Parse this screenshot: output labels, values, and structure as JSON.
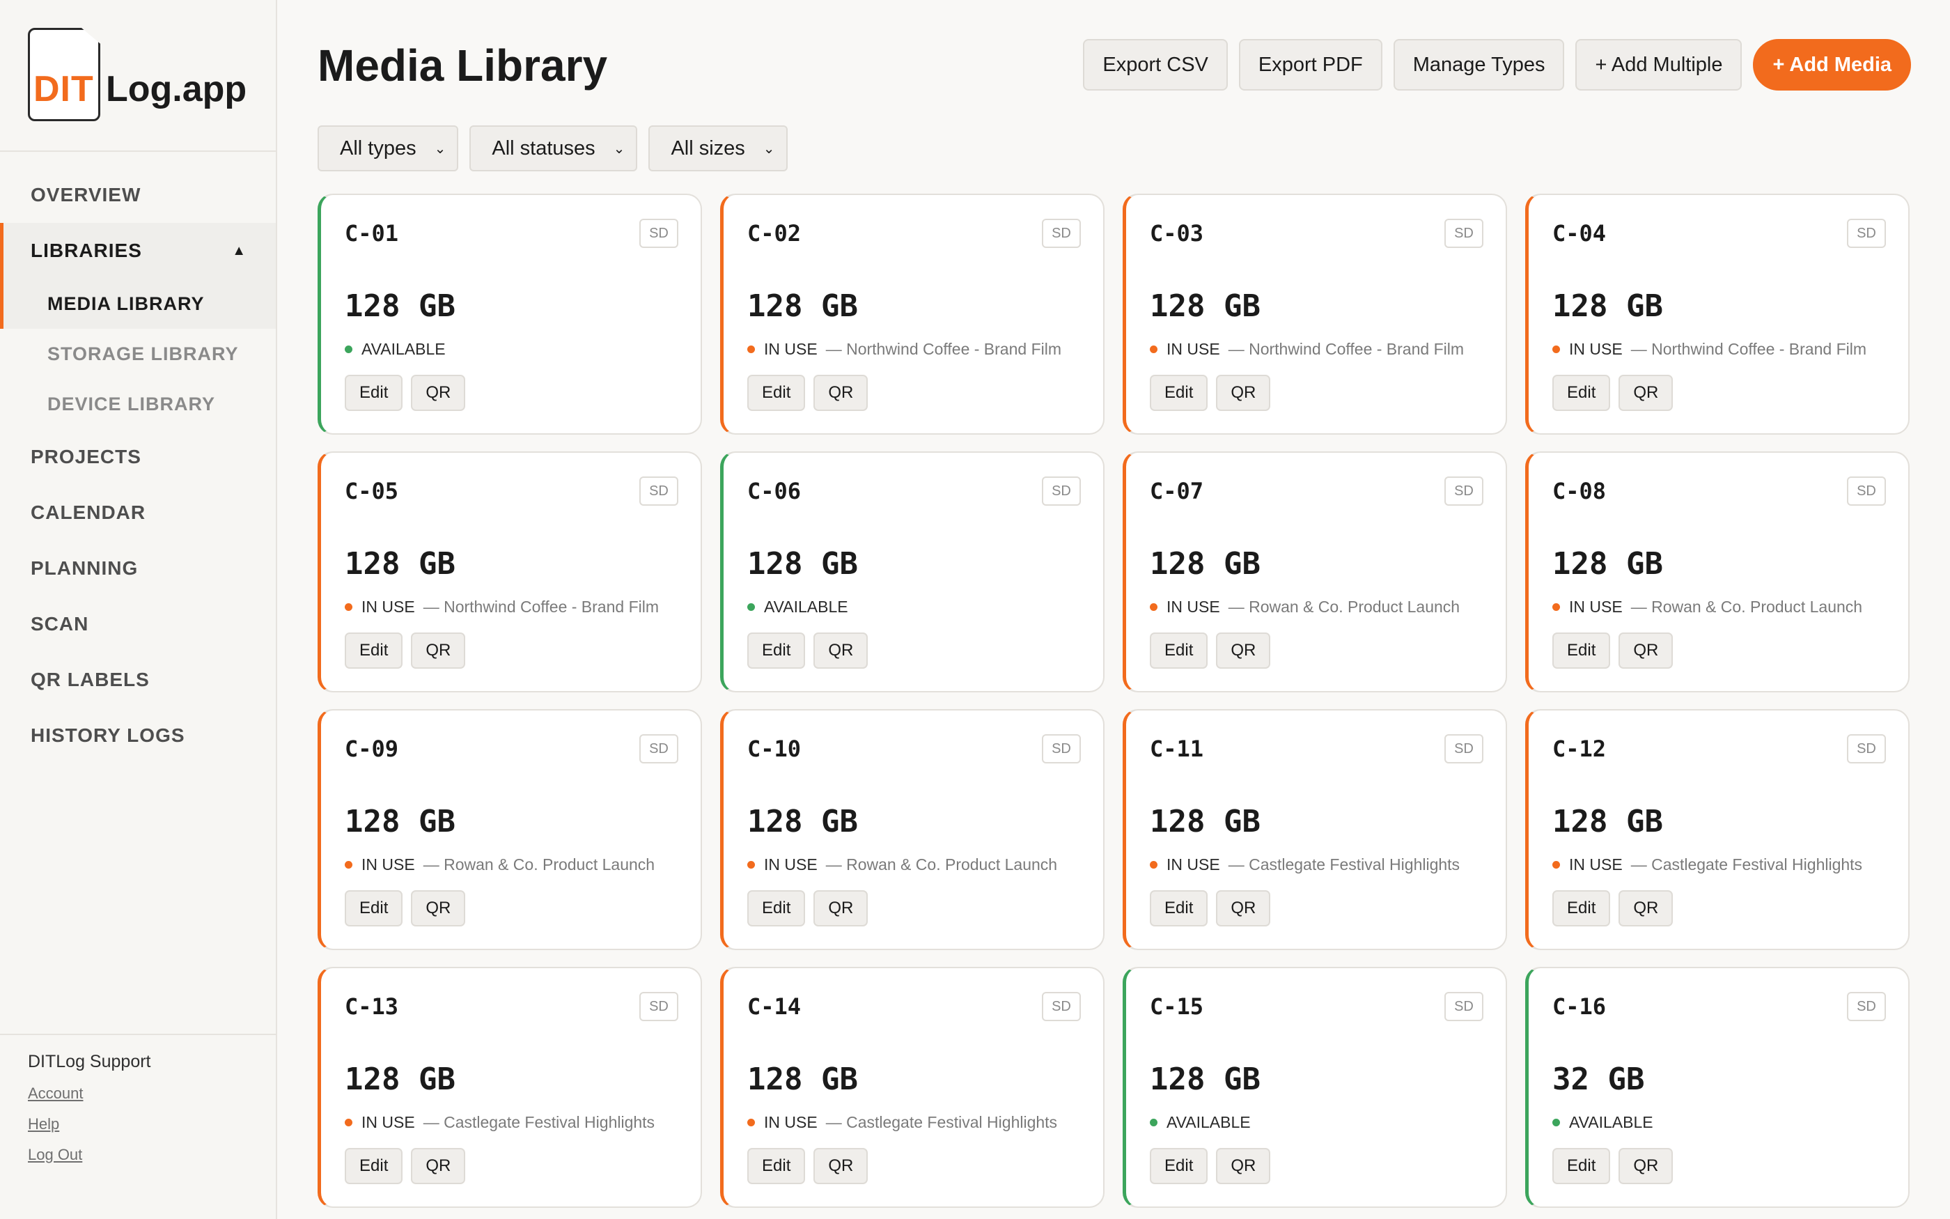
{
  "brand": {
    "logo_prefix": "DIT",
    "logo_suffix": "Log.app"
  },
  "sidebar": {
    "nav": [
      {
        "label": "OVERVIEW"
      },
      {
        "label": "LIBRARIES",
        "expanded_indicator": "▲"
      },
      {
        "label": "PROJECTS"
      },
      {
        "label": "CALENDAR"
      },
      {
        "label": "PLANNING"
      },
      {
        "label": "SCAN"
      },
      {
        "label": "QR LABELS"
      },
      {
        "label": "HISTORY LOGS"
      }
    ],
    "libraries_sub": [
      {
        "label": "MEDIA LIBRARY"
      },
      {
        "label": "STORAGE LIBRARY"
      },
      {
        "label": "DEVICE LIBRARY"
      }
    ],
    "footer": {
      "support": "DITLog Support",
      "links": [
        "Account",
        "Help",
        "Log Out"
      ]
    }
  },
  "header": {
    "title": "Media Library",
    "actions": [
      "Export CSV",
      "Export PDF",
      "Manage Types",
      "+ Add Multiple",
      "+ Add Media"
    ]
  },
  "filters": {
    "type": "All types",
    "status": "All statuses",
    "size": "All sizes"
  },
  "colors": {
    "accent": "#f26b1d",
    "in_use": "#f26b1d",
    "available": "#3ca55c"
  },
  "card_actions": {
    "edit": "Edit",
    "qr": "QR"
  },
  "media": [
    {
      "id": "C-01",
      "type": "SD",
      "size": "128 GB",
      "status": "AVAILABLE",
      "project": ""
    },
    {
      "id": "C-02",
      "type": "SD",
      "size": "128 GB",
      "status": "IN USE",
      "project": "— Northwind Coffee - Brand Film"
    },
    {
      "id": "C-03",
      "type": "SD",
      "size": "128 GB",
      "status": "IN USE",
      "project": "— Northwind Coffee - Brand Film"
    },
    {
      "id": "C-04",
      "type": "SD",
      "size": "128 GB",
      "status": "IN USE",
      "project": "— Northwind Coffee - Brand Film"
    },
    {
      "id": "C-05",
      "type": "SD",
      "size": "128 GB",
      "status": "IN USE",
      "project": "— Northwind Coffee - Brand Film"
    },
    {
      "id": "C-06",
      "type": "SD",
      "size": "128 GB",
      "status": "AVAILABLE",
      "project": ""
    },
    {
      "id": "C-07",
      "type": "SD",
      "size": "128 GB",
      "status": "IN USE",
      "project": "— Rowan & Co. Product Launch"
    },
    {
      "id": "C-08",
      "type": "SD",
      "size": "128 GB",
      "status": "IN USE",
      "project": "— Rowan & Co. Product Launch"
    },
    {
      "id": "C-09",
      "type": "SD",
      "size": "128 GB",
      "status": "IN USE",
      "project": "— Rowan & Co. Product Launch"
    },
    {
      "id": "C-10",
      "type": "SD",
      "size": "128 GB",
      "status": "IN USE",
      "project": "— Rowan & Co. Product Launch"
    },
    {
      "id": "C-11",
      "type": "SD",
      "size": "128 GB",
      "status": "IN USE",
      "project": "— Castlegate Festival Highlights"
    },
    {
      "id": "C-12",
      "type": "SD",
      "size": "128 GB",
      "status": "IN USE",
      "project": "— Castlegate Festival Highlights"
    },
    {
      "id": "C-13",
      "type": "SD",
      "size": "128 GB",
      "status": "IN USE",
      "project": "— Castlegate Festival Highlights"
    },
    {
      "id": "C-14",
      "type": "SD",
      "size": "128 GB",
      "status": "IN USE",
      "project": "— Castlegate Festival Highlights"
    },
    {
      "id": "C-15",
      "type": "SD",
      "size": "128 GB",
      "status": "AVAILABLE",
      "project": ""
    },
    {
      "id": "C-16",
      "type": "SD",
      "size": "32 GB",
      "status": "AVAILABLE",
      "project": ""
    }
  ]
}
